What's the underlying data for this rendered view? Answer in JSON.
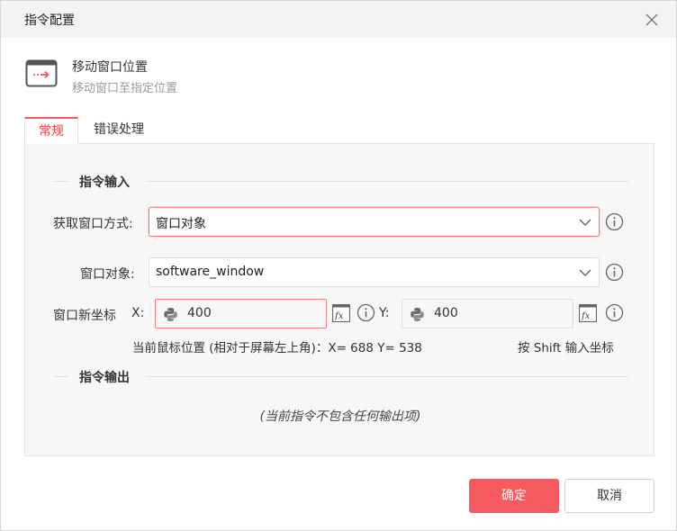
{
  "dialog": {
    "title": "指令配置",
    "close_icon": "close-icon"
  },
  "command": {
    "icon": "window-move-icon",
    "name": "移动窗口位置",
    "description": "移动窗口至指定位置"
  },
  "tabs": [
    {
      "label": "常规",
      "active": true
    },
    {
      "label": "错误处理",
      "active": false
    }
  ],
  "input_section": {
    "title": "指令输入",
    "acquire_method": {
      "label": "获取窗口方式:",
      "value": "窗口对象"
    },
    "window_object": {
      "label": "窗口对象:",
      "value": "software_window"
    },
    "new_coords": {
      "label": "窗口新坐标",
      "x_label": "X:",
      "x_value": "400",
      "y_label": "Y:",
      "y_value": "400"
    },
    "mouse_hint": "当前鼠标位置 (相对于屏幕左上角)：X= 688 Y= 538",
    "shift_hint": "按 Shift 输入坐标"
  },
  "output_section": {
    "title": "指令输出",
    "empty_text": "(当前指令不包含任何输出项)"
  },
  "buttons": {
    "ok": "确定",
    "cancel": "取消"
  },
  "colors": {
    "accent": "#f45a60",
    "active_tab_text": "#e6414b",
    "panel_bg": "#f7f7f7"
  }
}
